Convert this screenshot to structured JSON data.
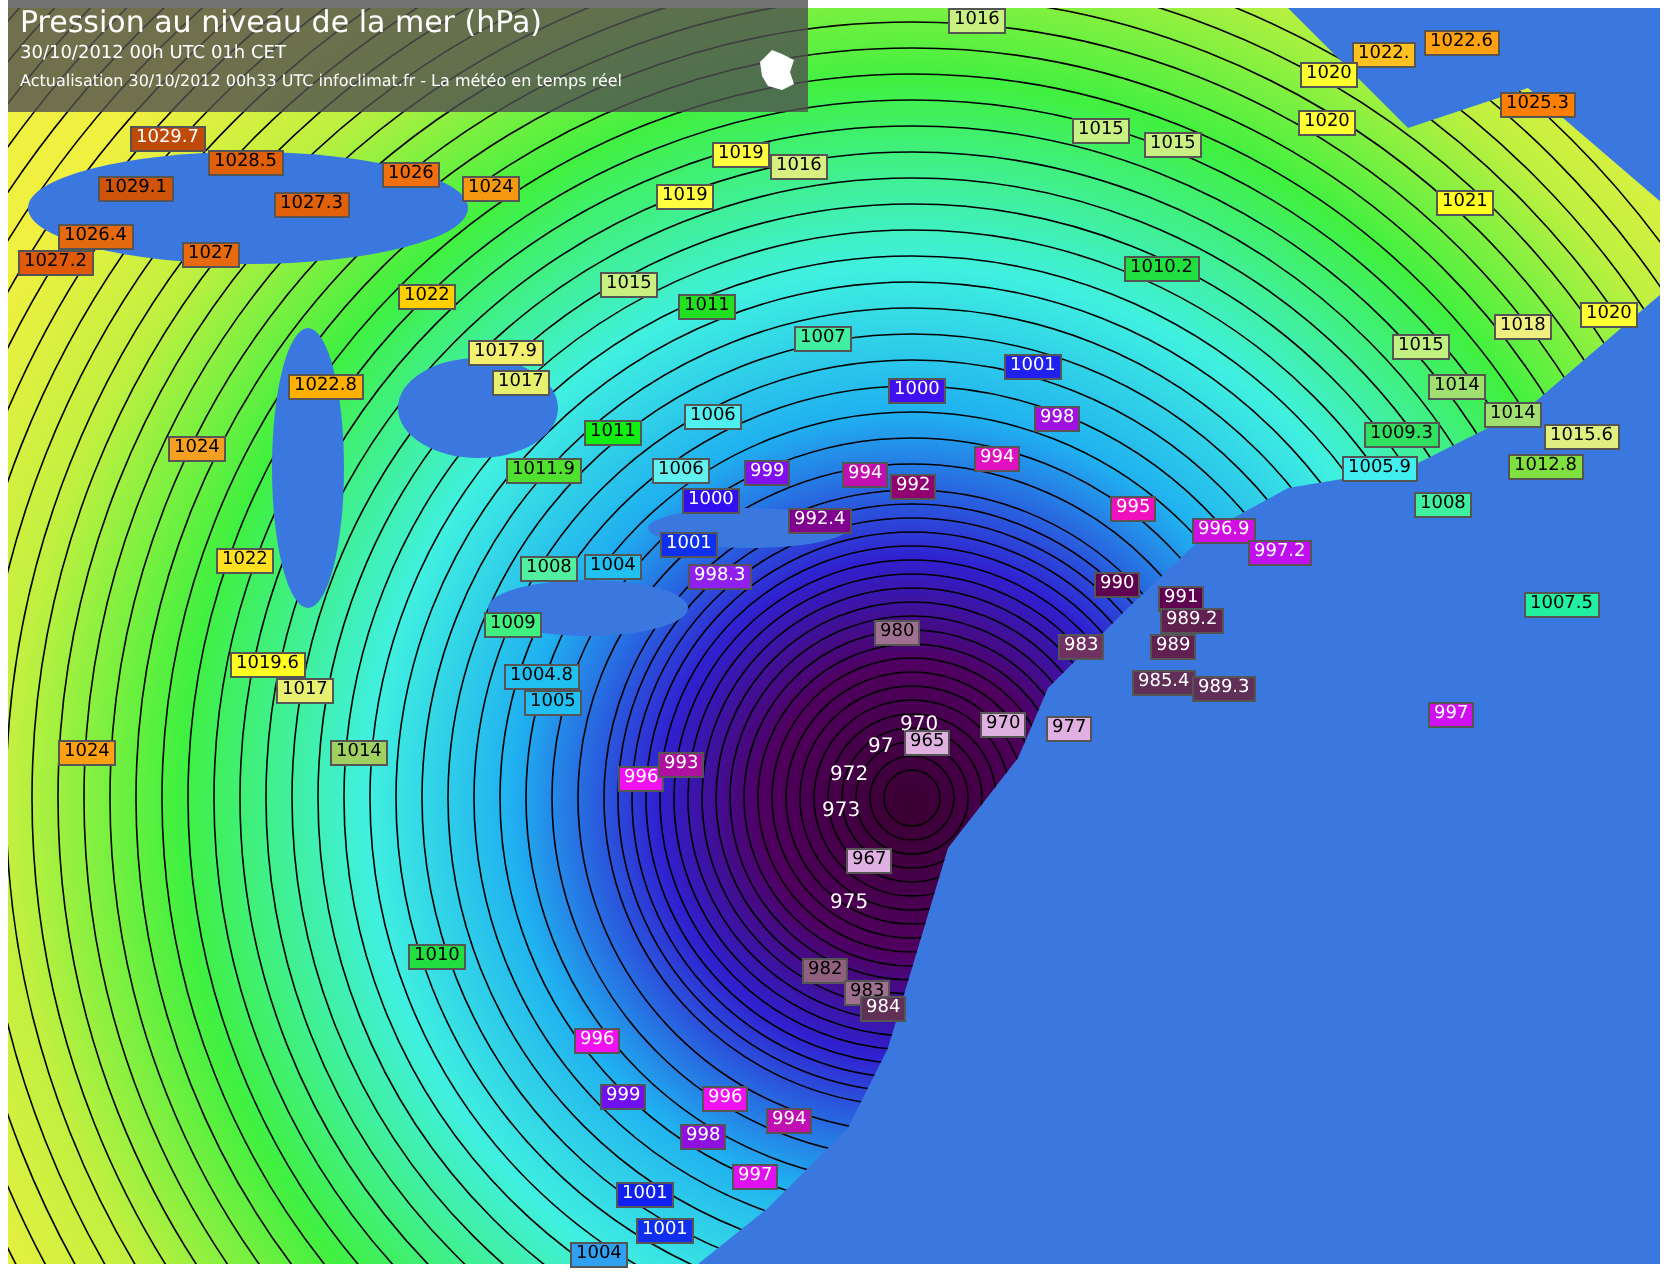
{
  "header": {
    "title": "Pression au niveau de la mer (hPa)",
    "date_line": "30/10/2012  00h UTC  01h CET",
    "update_line": "Actualisation 30/10/2012 00h33 UTC   infoclimat.fr - La météo en temps réel"
  },
  "stations": [
    {
      "kind": "tag",
      "text": "1029.7",
      "color": "#c04a08"
    },
    {
      "kind": "tag",
      "text": "1028.5",
      "color": "#e0600a"
    },
    {
      "kind": "tag",
      "text": "1029.1",
      "color": "#d0550a"
    },
    {
      "kind": "tag",
      "text": "1026.4",
      "color": "#e56a0f"
    },
    {
      "kind": "tag",
      "text": "1027.2",
      "color": "#e05a0a"
    },
    {
      "kind": "tag",
      "text": "1027",
      "color": "#e86a10"
    },
    {
      "kind": "tag",
      "text": "1027.3",
      "color": "#e0600b"
    },
    {
      "kind": "tag",
      "text": "1026",
      "color": "#f07010"
    },
    {
      "kind": "tag",
      "text": "1024",
      "color": "#f59a10"
    },
    {
      "kind": "tag",
      "text": "1022",
      "color": "#ffd000"
    },
    {
      "kind": "tag",
      "text": "1022.8",
      "color": "#ffb000"
    },
    {
      "kind": "tag",
      "text": "1017.9",
      "color": "#f4f070"
    },
    {
      "kind": "tag",
      "text": "1017",
      "color": "#e8f070"
    },
    {
      "kind": "tag",
      "text": "1024",
      "color": "#f5a020"
    },
    {
      "kind": "tag",
      "text": "1022",
      "color": "#ffe020"
    },
    {
      "kind": "tag",
      "text": "1019",
      "color": "#ffff40"
    },
    {
      "kind": "tag",
      "text": "1019",
      "color": "#ffff41"
    },
    {
      "kind": "tag",
      "text": "1016",
      "color": "#d8f080"
    },
    {
      "kind": "tag",
      "text": "1015",
      "color": "#c8f080"
    },
    {
      "kind": "tag",
      "text": "1011",
      "color": "#20e020"
    },
    {
      "kind": "tag",
      "text": "1007",
      "color": "#40f0a0"
    },
    {
      "kind": "tag",
      "text": "1006",
      "color": "#50f0f0"
    },
    {
      "kind": "tag",
      "text": "1011",
      "color": "#10f010"
    },
    {
      "kind": "tag",
      "text": "1011.9",
      "color": "#50e030"
    },
    {
      "kind": "tag",
      "text": "1006",
      "color": "#60f0f0"
    },
    {
      "kind": "tag",
      "text": "999",
      "color": "#8010f0"
    },
    {
      "kind": "tag",
      "text": "1000",
      "color": "#3010f0"
    },
    {
      "kind": "tag",
      "text": "992.4",
      "color": "#800090"
    },
    {
      "kind": "tag",
      "text": "1001",
      "color": "#1030f0"
    },
    {
      "kind": "tag",
      "text": "998.3",
      "color": "#9020f0"
    },
    {
      "kind": "tag",
      "text": "1008",
      "color": "#50f0a0"
    },
    {
      "kind": "tag",
      "text": "1004",
      "color": "#20c0f0"
    },
    {
      "kind": "tag",
      "text": "1009",
      "color": "#40f080"
    },
    {
      "kind": "tag",
      "text": "1016",
      "color": "#c8f081"
    },
    {
      "kind": "tag",
      "text": "1022.",
      "color": "#ffc020"
    },
    {
      "kind": "tag",
      "text": "1022.6",
      "color": "#ffa010"
    },
    {
      "kind": "tag",
      "text": "1020",
      "color": "#ffff30"
    },
    {
      "kind": "tag",
      "text": "1020",
      "color": "#ffff31"
    },
    {
      "kind": "tag",
      "text": "1025.3",
      "color": "#ff8000"
    },
    {
      "kind": "tag",
      "text": "1015",
      "color": "#c8f082"
    },
    {
      "kind": "tag",
      "text": "1015",
      "color": "#c8f083"
    },
    {
      "kind": "tag",
      "text": "1021",
      "color": "#ffff20"
    },
    {
      "kind": "tag",
      "text": "1010.2",
      "color": "#20e040"
    },
    {
      "kind": "tag",
      "text": "1001",
      "color": "#2020f0"
    },
    {
      "kind": "tag",
      "text": "1000",
      "color": "#4010f0"
    },
    {
      "kind": "tag",
      "text": "998",
      "color": "#a010e0"
    },
    {
      "kind": "tag",
      "text": "994",
      "color": "#e010c0"
    },
    {
      "kind": "tag",
      "text": "994",
      "color": "#c010b0"
    },
    {
      "kind": "tag",
      "text": "992",
      "color": "#900070"
    },
    {
      "kind": "tag",
      "text": "995",
      "color": "#f010c0"
    },
    {
      "kind": "tag",
      "text": "996.9",
      "color": "#d010e0"
    },
    {
      "kind": "tag",
      "text": "997.2",
      "color": "#c010f0"
    },
    {
      "kind": "tag",
      "text": "1020",
      "color": "#ffff32"
    },
    {
      "kind": "tag",
      "text": "1018",
      "color": "#f0f080"
    },
    {
      "kind": "tag",
      "text": "1015",
      "color": "#c0f080"
    },
    {
      "kind": "tag",
      "text": "1014",
      "color": "#a0e070"
    },
    {
      "kind": "tag",
      "text": "1014",
      "color": "#a0e071"
    },
    {
      "kind": "tag",
      "text": "1009.3",
      "color": "#30e060"
    },
    {
      "kind": "tag",
      "text": "1015.6",
      "color": "#e0f080"
    },
    {
      "kind": "tag",
      "text": "1005.9",
      "color": "#40f0f0"
    },
    {
      "kind": "tag",
      "text": "1012.8",
      "color": "#80e040"
    },
    {
      "kind": "tag",
      "text": "1008",
      "color": "#40f0a1"
    },
    {
      "kind": "tag",
      "text": "1007.5",
      "color": "#20f0a0"
    },
    {
      "kind": "tag",
      "text": "990",
      "color": "#600050"
    },
    {
      "kind": "tag",
      "text": "991",
      "color": "#600051"
    },
    {
      "kind": "tag",
      "text": "989.2",
      "color": "#602050"
    },
    {
      "kind": "tag",
      "text": "980",
      "color": "#a07090"
    },
    {
      "kind": "tag",
      "text": "1019.6",
      "color": "#ffff21"
    },
    {
      "kind": "tag",
      "text": "1017",
      "color": "#e8f071"
    },
    {
      "kind": "tag",
      "text": "1024",
      "color": "#ffa011"
    },
    {
      "kind": "tag",
      "text": "1014",
      "color": "#a0d060"
    },
    {
      "kind": "tag",
      "text": "1004.8",
      "color": "#20c0f1"
    },
    {
      "kind": "tag",
      "text": "1005",
      "color": "#20c0f2"
    },
    {
      "kind": "tag",
      "text": "996",
      "color": "#f010f0"
    },
    {
      "kind": "tag",
      "text": "993",
      "color": "#b010a0"
    },
    {
      "kind": "tag",
      "text": "1010",
      "color": "#20e041"
    },
    {
      "kind": "tag",
      "text": "996",
      "color": "#f010f1"
    },
    {
      "kind": "tag",
      "text": "999",
      "color": "#7010f0"
    },
    {
      "kind": "tag",
      "text": "996",
      "color": "#f010f2"
    },
    {
      "kind": "tag",
      "text": "994",
      "color": "#c010b1"
    },
    {
      "kind": "tag",
      "text": "998",
      "color": "#9010e0"
    },
    {
      "kind": "tag",
      "text": "997",
      "color": "#e010f0"
    },
    {
      "kind": "tag",
      "text": "1001",
      "color": "#1020f0"
    },
    {
      "kind": "tag",
      "text": "1001",
      "color": "#1030f1"
    },
    {
      "kind": "tag",
      "text": "1004",
      "color": "#30a0f0"
    },
    {
      "kind": "tag",
      "text": "982",
      "color": "#906080"
    },
    {
      "kind": "tag",
      "text": "983",
      "color": "#703060"
    },
    {
      "kind": "tag",
      "text": "989",
      "color": "#602051"
    },
    {
      "kind": "tag",
      "text": "985.4",
      "color": "#603058"
    },
    {
      "kind": "tag",
      "text": "989.3",
      "color": "#603059"
    },
    {
      "kind": "tag",
      "text": "997",
      "color": "#d010f1"
    },
    {
      "kind": "tag",
      "text": "970",
      "color": "#e0b0e0"
    },
    {
      "kind": "tag",
      "text": "965",
      "color": "#e0b0e1"
    },
    {
      "kind": "tag",
      "text": "977",
      "color": "#e0b0e2"
    },
    {
      "kind": "tag",
      "text": "967",
      "color": "#e0b0e3"
    },
    {
      "kind": "tag",
      "text": "983",
      "color": "#a07091"
    },
    {
      "kind": "tag",
      "text": "984",
      "color": "#603057"
    },
    {
      "kind": "bare",
      "text": "970"
    },
    {
      "kind": "bare",
      "text": "97"
    },
    {
      "kind": "bare",
      "text": "972"
    },
    {
      "kind": "bare",
      "text": "973"
    },
    {
      "kind": "bare",
      "text": "975"
    }
  ]
}
